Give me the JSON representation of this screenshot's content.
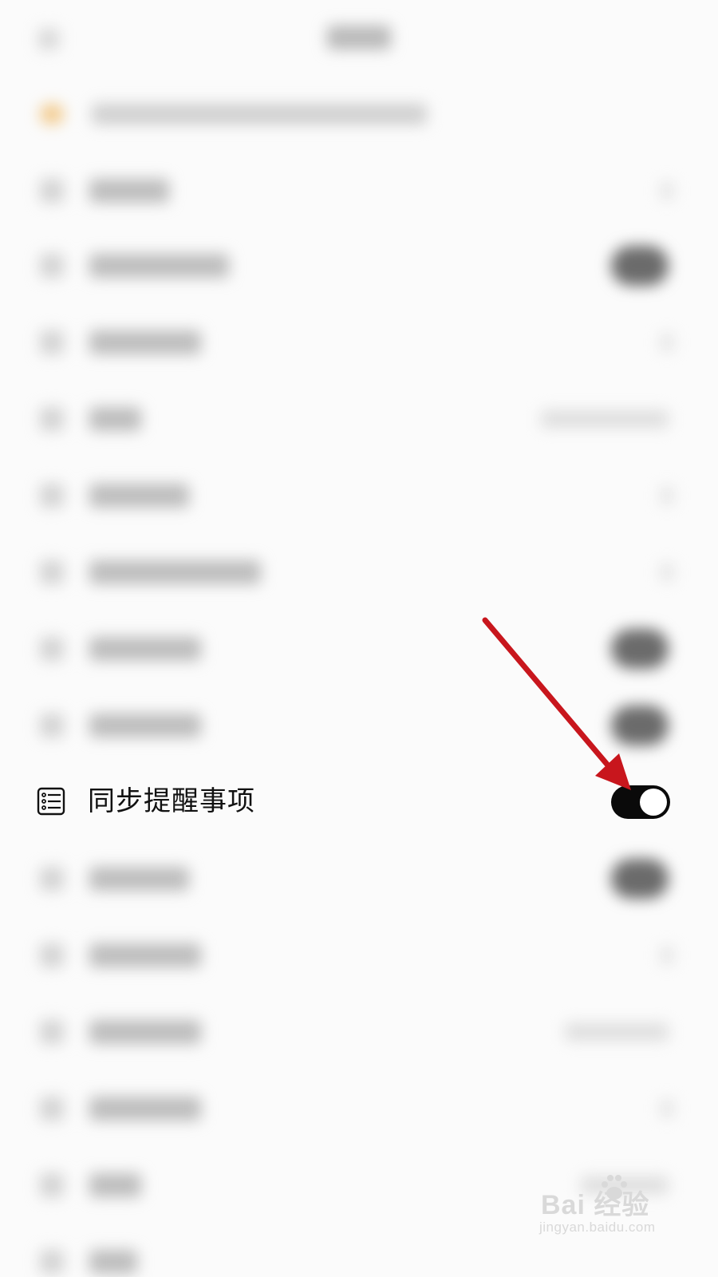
{
  "focused_setting": {
    "icon": "reminder-list-icon",
    "label": "同步提醒事项",
    "toggle_on": true
  },
  "watermark": {
    "brand": "Bai  经验",
    "site": "jingyan.baidu.com"
  },
  "colors": {
    "toggle_on": "#0a0a0a",
    "annotation_arrow": "#c8161d",
    "background": "#fbfbfb"
  }
}
